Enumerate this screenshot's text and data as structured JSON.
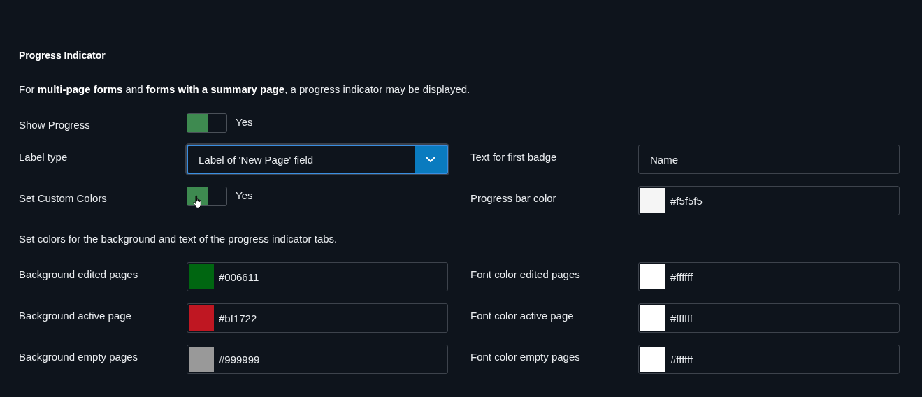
{
  "section": {
    "title": "Progress Indicator",
    "intro": "For **multi-page forms** and **forms with a summary page**, a progress indicator may be displayed."
  },
  "settings_rows": [
    {
      "fields": [
        {
          "kind": "toggle",
          "label": "Show Progress",
          "on": true,
          "text": "Yes"
        }
      ]
    },
    {
      "fields": [
        {
          "kind": "select",
          "label": "Label type",
          "value": "Label of 'New Page' field"
        },
        {
          "kind": "text",
          "label": "Text for first badge",
          "value": "Name"
        }
      ]
    },
    {
      "fields": [
        {
          "kind": "toggle",
          "label": "Set Custom Colors",
          "on": true,
          "text": "Yes"
        },
        {
          "kind": "color",
          "label": "Progress bar color",
          "value": "#f5f5f5",
          "color": "#f5f5f5"
        }
      ]
    }
  ],
  "colors_note": "Set colors for the background and text of the progress indicator tabs.",
  "color_rows": [
    {
      "fields": [
        {
          "kind": "color",
          "label": "Background edited pages",
          "value": "#006611",
          "color": "#006611"
        },
        {
          "kind": "color",
          "label": "Font color edited pages",
          "value": "#ffffff",
          "color": "#ffffff"
        }
      ]
    },
    {
      "fields": [
        {
          "kind": "color",
          "label": "Background active page",
          "value": "#bf1722",
          "color": "#bf1722"
        },
        {
          "kind": "color",
          "label": "Font color active page",
          "value": "#ffffff",
          "color": "#ffffff"
        }
      ]
    },
    {
      "fields": [
        {
          "kind": "color",
          "label": "Background empty pages",
          "value": "#999999",
          "color": "#999999"
        },
        {
          "kind": "color",
          "label": "Font color empty pages",
          "value": "#ffffff",
          "color": "#ffffff"
        }
      ]
    }
  ]
}
